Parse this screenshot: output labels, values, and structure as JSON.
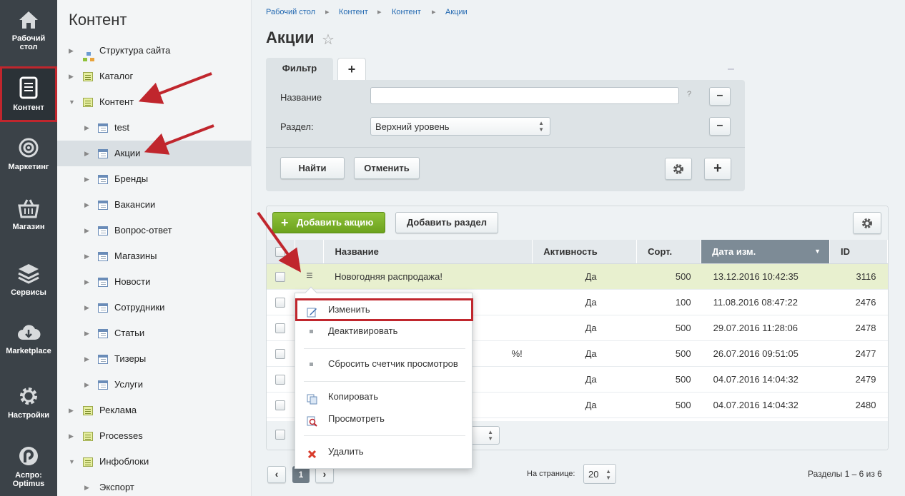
{
  "leftbar": {
    "items": [
      {
        "label_1": "Рабочий",
        "label_2": "стол",
        "icon": "home-icon"
      },
      {
        "label_1": "Контент",
        "label_2": "",
        "icon": "document-icon"
      },
      {
        "label_1": "Маркетинг",
        "label_2": "",
        "icon": "target-icon"
      },
      {
        "label_1": "Магазин",
        "label_2": "",
        "icon": "basket-icon"
      },
      {
        "label_1": "Сервисы",
        "label_2": "",
        "icon": "layers-icon"
      },
      {
        "label_1": "Marketplace",
        "label_2": "",
        "icon": "cloud-download-icon"
      },
      {
        "label_1": "Настройки",
        "label_2": "",
        "icon": "gear-icon"
      },
      {
        "label_1": "Аспро:",
        "label_2": "Optimus",
        "icon": "aspro-logo-icon"
      }
    ]
  },
  "tree": {
    "title": "Контент",
    "items": [
      {
        "label": "Структура сайта"
      },
      {
        "label": "Каталог"
      },
      {
        "label": "Контент"
      },
      {
        "label": "test"
      },
      {
        "label": "Акции"
      },
      {
        "label": "Бренды"
      },
      {
        "label": "Вакансии"
      },
      {
        "label": "Вопрос-ответ"
      },
      {
        "label": "Магазины"
      },
      {
        "label": "Новости"
      },
      {
        "label": "Сотрудники"
      },
      {
        "label": "Статьи"
      },
      {
        "label": "Тизеры"
      },
      {
        "label": "Услуги"
      },
      {
        "label": "Реклама"
      },
      {
        "label": "Processes"
      },
      {
        "label": "Инфоблоки"
      },
      {
        "label": "Экспорт"
      }
    ]
  },
  "breadcrumb": [
    "Рабочий стол",
    "Контент",
    "Контент",
    "Акции"
  ],
  "page_title": "Акции",
  "filter": {
    "tab_label": "Фильтр",
    "add_tab": "+",
    "collapse": "–",
    "name_label": "Название",
    "name_value": "",
    "help": "?",
    "section_label": "Раздел:",
    "section_value": "Верхний уровень",
    "find_label": "Найти",
    "cancel_label": "Отменить",
    "minus": "–",
    "plus": "+"
  },
  "toolbar": {
    "add_label": "Добавить акцию",
    "add_section_label": "Добавить раздел"
  },
  "grid": {
    "columns": [
      "Название",
      "Активность",
      "Сорт.",
      "Дата изм.",
      "ID"
    ],
    "rows": [
      {
        "name": "Новогодняя распродажа!",
        "active": "Да",
        "sort": "500",
        "date": "13.12.2016 10:42:35",
        "id": "3116"
      },
      {
        "name": "",
        "active": "Да",
        "sort": "100",
        "date": "11.08.2016 08:47:22",
        "id": "2476"
      },
      {
        "name": "",
        "active": "Да",
        "sort": "500",
        "date": "29.07.2016 11:28:06",
        "id": "2478"
      },
      {
        "name": "%!",
        "active": "Да",
        "sort": "500",
        "date": "26.07.2016 09:51:05",
        "id": "2477"
      },
      {
        "name": "",
        "active": "Да",
        "sort": "500",
        "date": "04.07.2016 14:04:32",
        "id": "2479"
      },
      {
        "name": "",
        "active": "Да",
        "sort": "500",
        "date": "04.07.2016 14:04:32",
        "id": "2480"
      }
    ]
  },
  "context_menu": {
    "edit": "Изменить",
    "deactivate": "Деактивировать",
    "reset_counter": "Сбросить счетчик просмотров",
    "copy": "Копировать",
    "view": "Просмотреть",
    "delete": "Удалить"
  },
  "pager": {
    "current_page": "1",
    "per_page_label": "На странице:",
    "per_page_value": "20",
    "summary": "Разделы 1 – 6 из 6"
  },
  "colors": {
    "accent_red": "#c0262d",
    "add_green": "#7cb32a",
    "link_blue": "#2067b0",
    "leftbar": "#3b4248"
  }
}
